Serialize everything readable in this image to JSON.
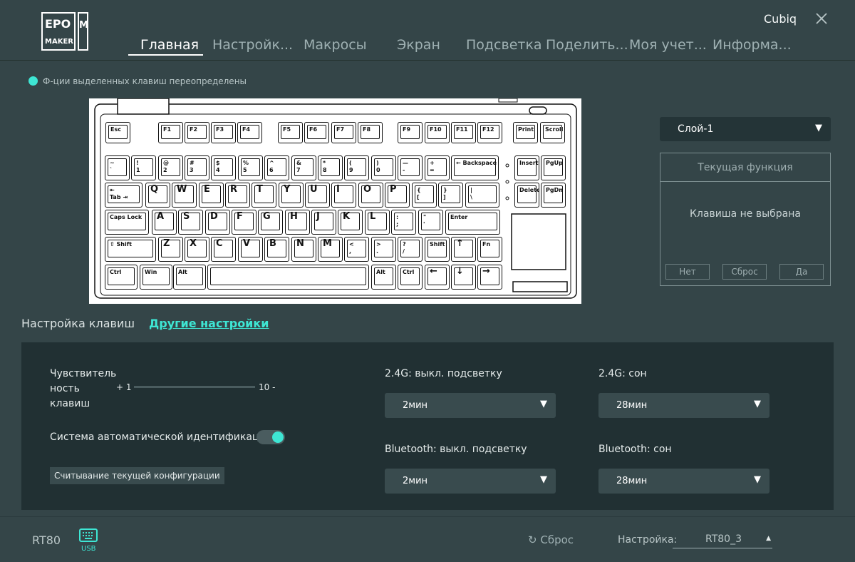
{
  "colors": {
    "accent": "#3ee6d4",
    "background": "#344548",
    "panel": "#213033"
  },
  "logo": {
    "text": "EPOMAKER"
  },
  "header": {
    "username": "Cubiq",
    "nav": [
      {
        "label": "Главная",
        "active": true
      },
      {
        "label": "Настройк..."
      },
      {
        "label": "Макросы"
      },
      {
        "label": "Экран"
      },
      {
        "label": "Подсветка"
      },
      {
        "label": "Поделить..."
      },
      {
        "label": "Моя учет..."
      },
      {
        "label": "Информа..."
      }
    ]
  },
  "notice": "Ф-ции выделенных клавиш переопределены",
  "keyboard": {
    "rows": [
      [
        "Esc",
        "F1",
        "F2",
        "F3",
        "F4",
        "F5",
        "F6",
        "F7",
        "F8",
        "F9",
        "F10",
        "F11",
        "F12",
        "Print",
        "Scroll"
      ],
      [
        "~\n`",
        "!\n1",
        "@\n2",
        "#\n3",
        "$\n4",
        "%\n5",
        "^\n6",
        "&\n7",
        "*\n8",
        "(\n9",
        ")\n0",
        "—\n-",
        "+\n=",
        "← Backspace",
        "Insert",
        "PgUp"
      ],
      [
        "⇤\nTab ⇥",
        "Q",
        "W",
        "E",
        "R",
        "T",
        "Y",
        "U",
        "I",
        "O",
        "P",
        "{\n[",
        "}\n]",
        "|\n\\",
        "Delete",
        "PgDn"
      ],
      [
        "Caps Lock",
        "A",
        "S",
        "D",
        "F",
        "G",
        "H",
        "J",
        "K",
        "L",
        ":\n;",
        "\"\n'",
        "Enter"
      ],
      [
        "⇧ Shift",
        "Z",
        "X",
        "C",
        "V",
        "B",
        "N",
        "M",
        "<\n,",
        ">\n.",
        "?\n/",
        "Shift",
        "↑",
        "Fn"
      ],
      [
        "Ctrl",
        "Win",
        "Alt",
        "",
        "Alt",
        "Ctrl",
        "←",
        "↓",
        "→"
      ]
    ]
  },
  "layer": {
    "selected": "Слой-1"
  },
  "function_panel": {
    "title": "Текущая функция",
    "status": "Клавиша не выбрана",
    "buttons": [
      "Нет",
      "Сброс",
      "Да"
    ]
  },
  "tabs": {
    "keys": "Настройка клавиш",
    "other": "Другие настройки"
  },
  "settings": {
    "sensitivity_label": "Чувствитель ность клавиш",
    "slider_min": "+ 1",
    "slider_max": "10 -",
    "auto_id_label": "Система автоматической идентификации",
    "auto_id_on": true,
    "read_config": "Считывание текущей конфигурации",
    "backlight_24g_label": "2.4G: выкл. подсветку",
    "backlight_24g_value": "2мин",
    "sleep_24g_label": "2.4G: сон",
    "sleep_24g_value": "28мин",
    "backlight_bt_label": "Bluetooth: выкл. подсветку",
    "backlight_bt_value": "2мин",
    "sleep_bt_label": "Bluetooth: сон",
    "sleep_bt_value": "28мин"
  },
  "footer": {
    "device": "RT80",
    "connection": "USB",
    "reset": "Сброс",
    "config_label": "Настройка:",
    "config_value": "RT80_3"
  }
}
